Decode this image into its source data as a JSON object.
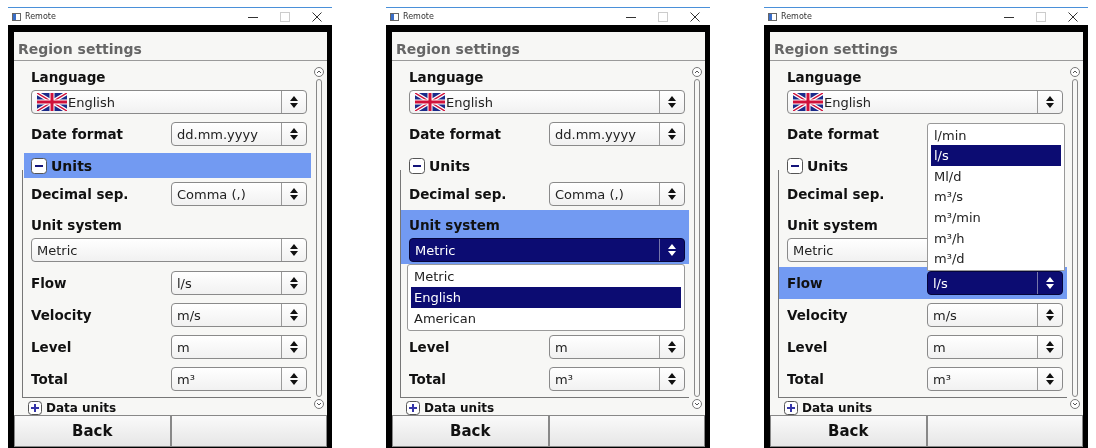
{
  "windows": [
    {
      "title": "Remote",
      "heading": "Region settings",
      "items": [
        {
          "kind": "flag-select",
          "label": "Language",
          "value": "English",
          "selected": false
        },
        {
          "kind": "inline-select",
          "label": "Date format",
          "value": "dd.mm.yyyy",
          "selected": false
        },
        {
          "kind": "group",
          "label": "Units",
          "expanded": true,
          "selected": true,
          "children": [
            {
              "kind": "inline-select",
              "label": "Decimal sep.",
              "value": "Comma (,)",
              "selected": false
            },
            {
              "kind": "stacked-select",
              "label": "Unit system",
              "value": "Metric",
              "selected": false
            },
            {
              "kind": "inline-select",
              "label": "Flow",
              "value": "l/s",
              "selected": false
            },
            {
              "kind": "inline-select",
              "label": "Velocity",
              "value": "m/s",
              "selected": false
            },
            {
              "kind": "inline-select",
              "label": "Level",
              "value": "m",
              "selected": false
            },
            {
              "kind": "inline-select",
              "label": "Total",
              "value": "m³",
              "selected": false
            }
          ]
        },
        {
          "kind": "group",
          "label": "Data units",
          "expanded": false,
          "selected": false
        }
      ],
      "buttons": [
        "Back"
      ]
    },
    {
      "title": "Remote",
      "heading": "Region settings",
      "items": [
        {
          "kind": "flag-select",
          "label": "Language",
          "value": "English",
          "selected": false
        },
        {
          "kind": "inline-select",
          "label": "Date format",
          "value": "dd.mm.yyyy",
          "selected": false
        },
        {
          "kind": "group",
          "label": "Units",
          "expanded": true,
          "selected": false,
          "children": [
            {
              "kind": "inline-select",
              "label": "Decimal sep.",
              "value": "Comma (,)",
              "selected": false
            },
            {
              "kind": "stacked-select",
              "label": "Unit system",
              "value": "Metric",
              "selected": true,
              "dropdown": {
                "open_above": false,
                "options": [
                  {
                    "label": "Metric",
                    "selected": false
                  },
                  {
                    "label": "English",
                    "selected": true
                  },
                  {
                    "label": "American",
                    "selected": false
                  }
                ]
              }
            },
            {
              "kind": "inline-select",
              "label": "Level",
              "value": "m",
              "selected": false
            },
            {
              "kind": "inline-select",
              "label": "Total",
              "value": "m³",
              "selected": false
            }
          ]
        },
        {
          "kind": "group",
          "label": "Data units",
          "expanded": false,
          "selected": false
        }
      ],
      "buttons": [
        "Back"
      ]
    },
    {
      "title": "Remote",
      "heading": "Region settings",
      "items": [
        {
          "kind": "flag-select",
          "label": "Language",
          "value": "English",
          "selected": false
        },
        {
          "kind": "inline-select",
          "label": "Date format",
          "selected": false
        },
        {
          "kind": "group",
          "label": "Units",
          "expanded": true,
          "selected": false,
          "children": [
            {
              "kind": "inline-select",
              "label": "Decimal sep.",
              "selected": false
            },
            {
              "kind": "stacked-select",
              "label": "Unit system",
              "value": "Metric",
              "selected": false
            },
            {
              "kind": "inline-select",
              "label": "Flow",
              "value": "l/s",
              "selected": true,
              "dropdown": {
                "open_above": true,
                "options": [
                  {
                    "label": "l/min",
                    "selected": false
                  },
                  {
                    "label": "l/s",
                    "selected": true
                  },
                  {
                    "label": "Ml/d",
                    "selected": false
                  },
                  {
                    "label": "m³/s",
                    "selected": false
                  },
                  {
                    "label": "m³/min",
                    "selected": false
                  },
                  {
                    "label": "m³/h",
                    "selected": false
                  },
                  {
                    "label": "m³/d",
                    "selected": false
                  }
                ]
              }
            },
            {
              "kind": "inline-select",
              "label": "Velocity",
              "value": "m/s",
              "selected": false
            },
            {
              "kind": "inline-select",
              "label": "Level",
              "value": "m",
              "selected": false
            },
            {
              "kind": "inline-select",
              "label": "Total",
              "value": "m³",
              "selected": false
            }
          ]
        },
        {
          "kind": "group",
          "label": "Data units",
          "expanded": false,
          "selected": false
        }
      ],
      "buttons": [
        "Back"
      ]
    }
  ]
}
